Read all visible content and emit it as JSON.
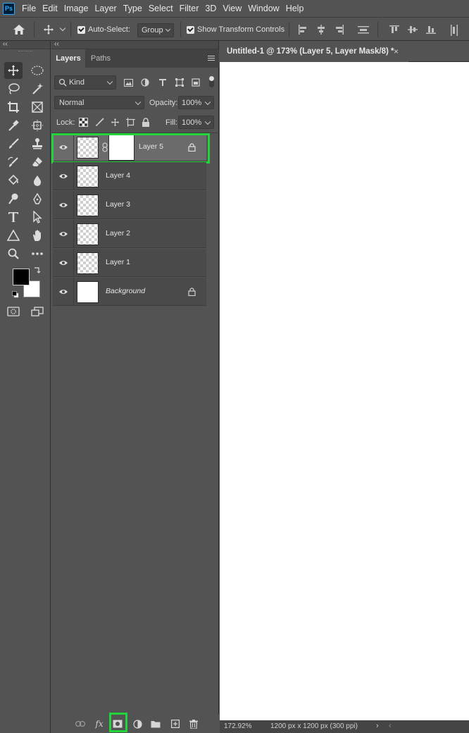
{
  "app": {
    "logo": "Ps",
    "menu": [
      "File",
      "Edit",
      "Image",
      "Layer",
      "Type",
      "Select",
      "Filter",
      "3D",
      "View",
      "Window",
      "Help"
    ]
  },
  "options_bar": {
    "auto_select_label": "Auto-Select:",
    "auto_select_checked": true,
    "auto_select_target": "Group",
    "show_transform_label": "Show Transform Controls",
    "show_transform_checked": true
  },
  "toolbar": {
    "collapse_glyph": "‹‹",
    "tools": [
      "move-tool-icon",
      "elliptical-marquee-icon",
      "lasso-icon",
      "magic-wand-icon",
      "crop-icon",
      "frame-icon",
      "eyedropper-icon",
      "healing-brush-icon",
      "brush-icon",
      "clone-stamp-icon",
      "history-brush-icon",
      "eraser-icon",
      "paint-bucket-icon",
      "blur-icon",
      "dodge-icon",
      "pen-icon",
      "type-icon",
      "path-selection-icon",
      "shape-icon",
      "hand-icon",
      "zoom-icon",
      "more-tools-icon"
    ],
    "foreground_color": "#000000",
    "background_color": "#ffffff"
  },
  "layers_panel": {
    "tabs": [
      "Layers",
      "Paths"
    ],
    "active_tab": "Layers",
    "filter_kind": "Kind",
    "blend_mode": "Normal",
    "opacity_label": "Opacity:",
    "opacity_value": "100%",
    "lock_label": "Lock:",
    "fill_label": "Fill:",
    "fill_value": "100%",
    "layers": [
      {
        "name": "Layer 5",
        "selected": true,
        "has_mask": true,
        "locked": true,
        "thumb": "transparent"
      },
      {
        "name": "Layer 4",
        "selected": false,
        "has_mask": false,
        "locked": false,
        "thumb": "transparent"
      },
      {
        "name": "Layer 3",
        "selected": false,
        "has_mask": false,
        "locked": false,
        "thumb": "transparent"
      },
      {
        "name": "Layer 2",
        "selected": false,
        "has_mask": false,
        "locked": false,
        "thumb": "transparent"
      },
      {
        "name": "Layer 1",
        "selected": false,
        "has_mask": false,
        "locked": false,
        "thumb": "transparent"
      },
      {
        "name": "Background",
        "selected": false,
        "has_mask": false,
        "locked": true,
        "thumb": "white",
        "italic": true
      }
    ],
    "bottom_fx_label": "fx",
    "highlight_color": "#22d43b"
  },
  "document": {
    "tab_title": "Untitled-1 @ 173% (Layer 5, Layer Mask/8) *",
    "close_glyph": "×",
    "zoom": "172.92%",
    "doc_info": "1200 px x 1200 px (300 ppi)"
  }
}
